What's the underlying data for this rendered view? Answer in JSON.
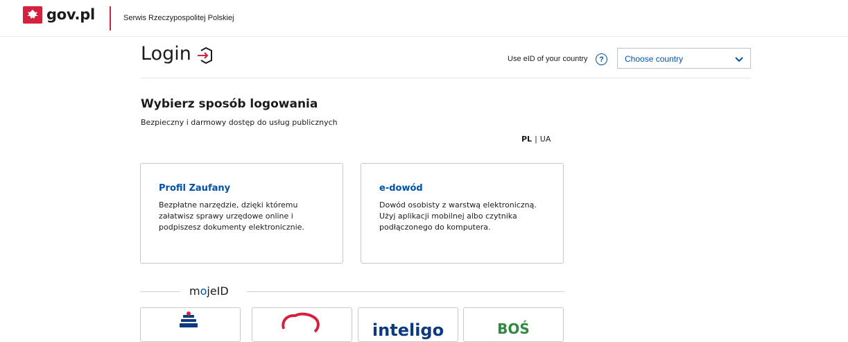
{
  "header": {
    "logo_text": "gov.pl",
    "service_name": "Serwis Rzeczypospolitej Polskiej",
    "brand_red": "#d4213d"
  },
  "login": {
    "title": "Login",
    "eid_label": "Use eID of your country",
    "help_icon": "?",
    "country_select": {
      "selected": "Choose country"
    }
  },
  "section": {
    "title": "Wybierz sposób logowania",
    "subtitle": "Bezpieczny i darmowy dostęp do usług publicznych"
  },
  "languages": {
    "active": "PL",
    "separator": "|",
    "other": "UA"
  },
  "cards": [
    {
      "title": "Profil Zaufany",
      "description": "Bezpłatne narzędzie, dzięki któremu załatwisz sprawy urzędowe online i podpiszesz dokumenty elektronicznie."
    },
    {
      "title": "e-dowód",
      "description": "Dowód osobisty z warstwą elektroniczną. Użyj aplikacji mobilnej albo czytnika podłączonego do komputera."
    }
  ],
  "mojeid": {
    "label_part1": "m",
    "label_dot": "o",
    "label_part2": "jeID"
  },
  "banks": [
    {
      "icon": "pko-bank-logo-icon",
      "text": ""
    },
    {
      "icon": "bank-red-logo-icon",
      "text": ""
    },
    {
      "icon": "inteligo-logo-icon",
      "text": "inteligo"
    },
    {
      "icon": "bos-bank-logo-icon",
      "text": "BOŚ"
    }
  ],
  "colors": {
    "accent": "#0052a5",
    "text": "#1b1b1b",
    "border": "#c8c8c8"
  }
}
